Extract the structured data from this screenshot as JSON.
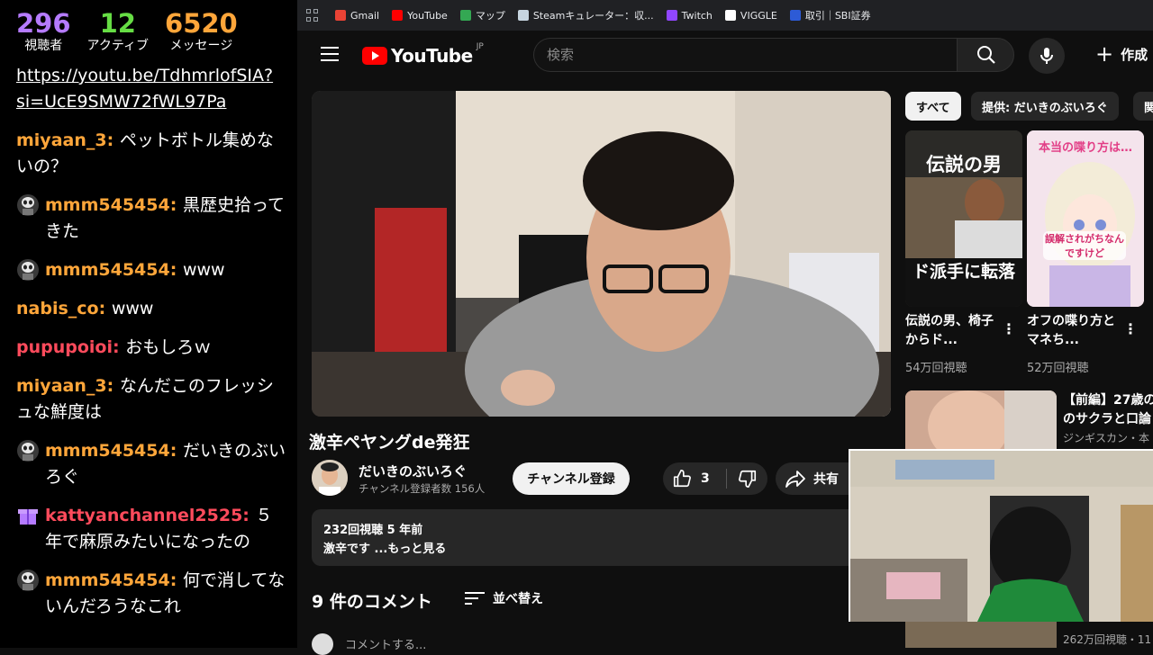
{
  "stats": [
    {
      "value": "296",
      "label": "視聴者",
      "color": "#b57bff"
    },
    {
      "value": "12",
      "label": "アクティブ",
      "color": "#66dd44"
    },
    {
      "value": "6520",
      "label": "メッセージ",
      "color": "#ffa63a"
    }
  ],
  "chat": {
    "link_line1": "https://youtu.be/TdhmrlofSIA?",
    "link_line2": "si=UcE9SMW72fWL97Pa",
    "messages": [
      {
        "user": "miyaan_3",
        "color": "#ffa63a",
        "text": "ペットボトル集めないの？",
        "icon": "none"
      },
      {
        "user": "mmm545454",
        "color": "#ffa63a",
        "text": "黒歴史拾ってきた",
        "icon": "avatar-icon"
      },
      {
        "user": "mmm545454",
        "color": "#ffa63a",
        "text": "www",
        "icon": "avatar-icon"
      },
      {
        "user": "nabis_co",
        "color": "#ffa63a",
        "text": "www",
        "icon": "none"
      },
      {
        "user": "pupupoioi",
        "color": "#ff4b5c",
        "text": "おもしろｗ",
        "icon": "none"
      },
      {
        "user": "miyaan_3",
        "color": "#ffa63a",
        "text": "なんだこのフレッシュな鮮度は",
        "icon": "none"
      },
      {
        "user": "mmm545454",
        "color": "#ffa63a",
        "text": "だいきのぶいろぐ",
        "icon": "avatar-icon"
      },
      {
        "user": "kattyanchannel2525",
        "color": "#ff4b5c",
        "text": "５年で麻原みたいになったの",
        "icon": "gift-icon"
      },
      {
        "user": "mmm545454",
        "color": "#ffa63a",
        "text": "何で消してないんだろうなこれ",
        "icon": "avatar-icon"
      }
    ]
  },
  "bookmarks": [
    {
      "label": "Gmail",
      "color": "#ea4335"
    },
    {
      "label": "YouTube",
      "color": "#ff0000"
    },
    {
      "label": "マップ",
      "color": "#34a853"
    },
    {
      "label": "Steamキュレーター：収...",
      "color": "#c7d5e0"
    },
    {
      "label": "Twitch",
      "color": "#9146ff"
    },
    {
      "label": "VIGGLE",
      "color": "#ffffff"
    },
    {
      "label": "取引｜SBI証券",
      "color": "#2d5bd6"
    }
  ],
  "header": {
    "logo_text": "YouTube",
    "logo_region": "JP",
    "search_placeholder": "検索",
    "create_label": "作成"
  },
  "video": {
    "title": "激辛ペヤングde発狂",
    "channel": "だいきのぶいろぐ",
    "subscribers": "チャンネル登録者数 156人",
    "subscribe_label": "チャンネル登録",
    "likes": "3",
    "share_label": "共有",
    "views_meta": "232回視聴  5 年前",
    "description": "激辛です  ...もっと見る"
  },
  "comments": {
    "title": "9 件のコメント",
    "sort_label": "並べ替え",
    "placeholder": "コメントする..."
  },
  "sidebar": {
    "chips": [
      "すべて",
      "提供: だいきのぶいろぐ",
      "関"
    ],
    "shorts": [
      {
        "title": "伝説の男、椅子からド...",
        "views": "54万回視聴",
        "thumb_top": "伝説の男",
        "thumb_bottom": "ド派手に転落"
      },
      {
        "title": "オフの喋り方とマネち...",
        "views": "52万回視聴",
        "thumb_top": "本当の喋り方は…",
        "thumb_bottom": "誤解されがちなんですけど"
      }
    ],
    "rec_title_line1": "【前編】27歳の",
    "rec_title_line2": "のサクラと口論",
    "rec_channel": "ジンギスカン・本",
    "rec_views": "262万回視聴・11"
  }
}
